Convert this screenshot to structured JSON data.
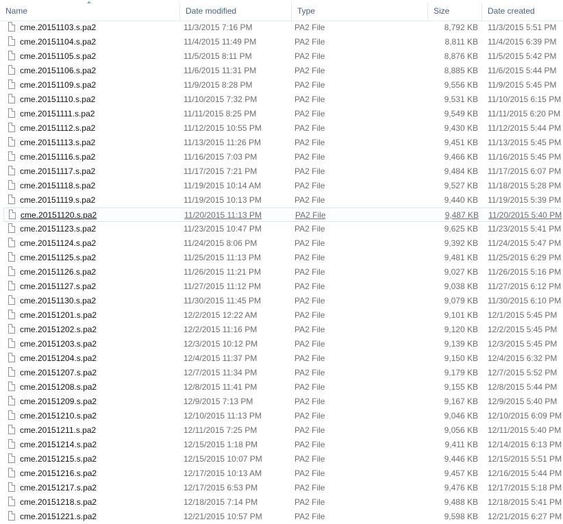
{
  "header": {
    "columns": [
      {
        "key": "name",
        "label": "Name"
      },
      {
        "key": "modified",
        "label": "Date modified"
      },
      {
        "key": "type",
        "label": "Type"
      },
      {
        "key": "size",
        "label": "Size"
      },
      {
        "key": "created",
        "label": "Date created"
      }
    ],
    "sort_column": "name",
    "sort_direction": "ascending"
  },
  "selected_file": "cme.20151120.s.pa2",
  "icons": {
    "file": "blank-file-icon",
    "sort": "sort-up-icon"
  },
  "files": [
    {
      "name": "cme.20151103.s.pa2",
      "modified": "11/3/2015 7:16 PM",
      "type": "PA2 File",
      "size": "8,792 KB",
      "created": "11/3/2015 5:51 PM"
    },
    {
      "name": "cme.20151104.s.pa2",
      "modified": "11/4/2015 11:49 PM",
      "type": "PA2 File",
      "size": "8,811 KB",
      "created": "11/4/2015 6:39 PM"
    },
    {
      "name": "cme.20151105.s.pa2",
      "modified": "11/5/2015 8:11 PM",
      "type": "PA2 File",
      "size": "8,876 KB",
      "created": "11/5/2015 5:42 PM"
    },
    {
      "name": "cme.20151106.s.pa2",
      "modified": "11/6/2015 11:31 PM",
      "type": "PA2 File",
      "size": "8,885 KB",
      "created": "11/6/2015 5:44 PM"
    },
    {
      "name": "cme.20151109.s.pa2",
      "modified": "11/9/2015 8:28 PM",
      "type": "PA2 File",
      "size": "9,556 KB",
      "created": "11/9/2015 5:45 PM"
    },
    {
      "name": "cme.20151110.s.pa2",
      "modified": "11/10/2015 7:32 PM",
      "type": "PA2 File",
      "size": "9,531 KB",
      "created": "11/10/2015 6:15 PM"
    },
    {
      "name": "cme.20151111.s.pa2",
      "modified": "11/11/2015 8:25 PM",
      "type": "PA2 File",
      "size": "9,549 KB",
      "created": "11/11/2015 6:20 PM"
    },
    {
      "name": "cme.20151112.s.pa2",
      "modified": "11/12/2015 10:55 PM",
      "type": "PA2 File",
      "size": "9,430 KB",
      "created": "11/12/2015 5:44 PM"
    },
    {
      "name": "cme.20151113.s.pa2",
      "modified": "11/13/2015 11:26 PM",
      "type": "PA2 File",
      "size": "9,451 KB",
      "created": "11/13/2015 5:45 PM"
    },
    {
      "name": "cme.20151116.s.pa2",
      "modified": "11/16/2015 7:03 PM",
      "type": "PA2 File",
      "size": "9,466 KB",
      "created": "11/16/2015 5:45 PM"
    },
    {
      "name": "cme.20151117.s.pa2",
      "modified": "11/17/2015 7:21 PM",
      "type": "PA2 File",
      "size": "9,484 KB",
      "created": "11/17/2015 6:07 PM"
    },
    {
      "name": "cme.20151118.s.pa2",
      "modified": "11/19/2015 10:14 AM",
      "type": "PA2 File",
      "size": "9,527 KB",
      "created": "11/18/2015 5:28 PM"
    },
    {
      "name": "cme.20151119.s.pa2",
      "modified": "11/19/2015 10:13 PM",
      "type": "PA2 File",
      "size": "9,440 KB",
      "created": "11/19/2015 5:39 PM"
    },
    {
      "name": "cme.20151120.s.pa2",
      "modified": "11/20/2015 11:13 PM",
      "type": "PA2 File",
      "size": "9,487 KB",
      "created": "11/20/2015 5:40 PM"
    },
    {
      "name": "cme.20151123.s.pa2",
      "modified": "11/23/2015 10:47 PM",
      "type": "PA2 File",
      "size": "9,625 KB",
      "created": "11/23/2015 5:41 PM"
    },
    {
      "name": "cme.20151124.s.pa2",
      "modified": "11/24/2015 8:06 PM",
      "type": "PA2 File",
      "size": "9,392 KB",
      "created": "11/24/2015 5:47 PM"
    },
    {
      "name": "cme.20151125.s.pa2",
      "modified": "11/25/2015 11:13 PM",
      "type": "PA2 File",
      "size": "9,481 KB",
      "created": "11/25/2015 6:29 PM"
    },
    {
      "name": "cme.20151126.s.pa2",
      "modified": "11/26/2015 11:21 PM",
      "type": "PA2 File",
      "size": "9,027 KB",
      "created": "11/26/2015 5:16 PM"
    },
    {
      "name": "cme.20151127.s.pa2",
      "modified": "11/27/2015 11:12 PM",
      "type": "PA2 File",
      "size": "9,038 KB",
      "created": "11/27/2015 6:12 PM"
    },
    {
      "name": "cme.20151130.s.pa2",
      "modified": "11/30/2015 11:45 PM",
      "type": "PA2 File",
      "size": "9,079 KB",
      "created": "11/30/2015 6:10 PM"
    },
    {
      "name": "cme.20151201.s.pa2",
      "modified": "12/2/2015 12:22 AM",
      "type": "PA2 File",
      "size": "9,101 KB",
      "created": "12/1/2015 5:45 PM"
    },
    {
      "name": "cme.20151202.s.pa2",
      "modified": "12/2/2015 11:16 PM",
      "type": "PA2 File",
      "size": "9,120 KB",
      "created": "12/2/2015 5:45 PM"
    },
    {
      "name": "cme.20151203.s.pa2",
      "modified": "12/3/2015 10:12 PM",
      "type": "PA2 File",
      "size": "9,139 KB",
      "created": "12/3/2015 5:45 PM"
    },
    {
      "name": "cme.20151204.s.pa2",
      "modified": "12/4/2015 11:37 PM",
      "type": "PA2 File",
      "size": "9,150 KB",
      "created": "12/4/2015 6:32 PM"
    },
    {
      "name": "cme.20151207.s.pa2",
      "modified": "12/7/2015 11:34 PM",
      "type": "PA2 File",
      "size": "9,179 KB",
      "created": "12/7/2015 5:52 PM"
    },
    {
      "name": "cme.20151208.s.pa2",
      "modified": "12/8/2015 11:41 PM",
      "type": "PA2 File",
      "size": "9,155 KB",
      "created": "12/8/2015 5:44 PM"
    },
    {
      "name": "cme.20151209.s.pa2",
      "modified": "12/9/2015 7:13 PM",
      "type": "PA2 File",
      "size": "9,167 KB",
      "created": "12/9/2015 5:40 PM"
    },
    {
      "name": "cme.20151210.s.pa2",
      "modified": "12/10/2015 11:13 PM",
      "type": "PA2 File",
      "size": "9,046 KB",
      "created": "12/10/2015 6:09 PM"
    },
    {
      "name": "cme.20151211.s.pa2",
      "modified": "12/11/2015 7:25 PM",
      "type": "PA2 File",
      "size": "9,056 KB",
      "created": "12/11/2015 5:40 PM"
    },
    {
      "name": "cme.20151214.s.pa2",
      "modified": "12/15/2015 1:18 PM",
      "type": "PA2 File",
      "size": "9,411 KB",
      "created": "12/14/2015 6:13 PM"
    },
    {
      "name": "cme.20151215.s.pa2",
      "modified": "12/15/2015 10:07 PM",
      "type": "PA2 File",
      "size": "9,446 KB",
      "created": "12/15/2015 5:51 PM"
    },
    {
      "name": "cme.20151216.s.pa2",
      "modified": "12/17/2015 10:13 AM",
      "type": "PA2 File",
      "size": "9,457 KB",
      "created": "12/16/2015 5:44 PM"
    },
    {
      "name": "cme.20151217.s.pa2",
      "modified": "12/17/2015 6:53 PM",
      "type": "PA2 File",
      "size": "9,476 KB",
      "created": "12/17/2015 5:18 PM"
    },
    {
      "name": "cme.20151218.s.pa2",
      "modified": "12/18/2015 7:14 PM",
      "type": "PA2 File",
      "size": "9,488 KB",
      "created": "12/18/2015 5:41 PM"
    },
    {
      "name": "cme.20151221.s.pa2",
      "modified": "12/21/2015 10:57 PM",
      "type": "PA2 File",
      "size": "9,598 KB",
      "created": "12/21/2015 6:27 PM"
    }
  ]
}
